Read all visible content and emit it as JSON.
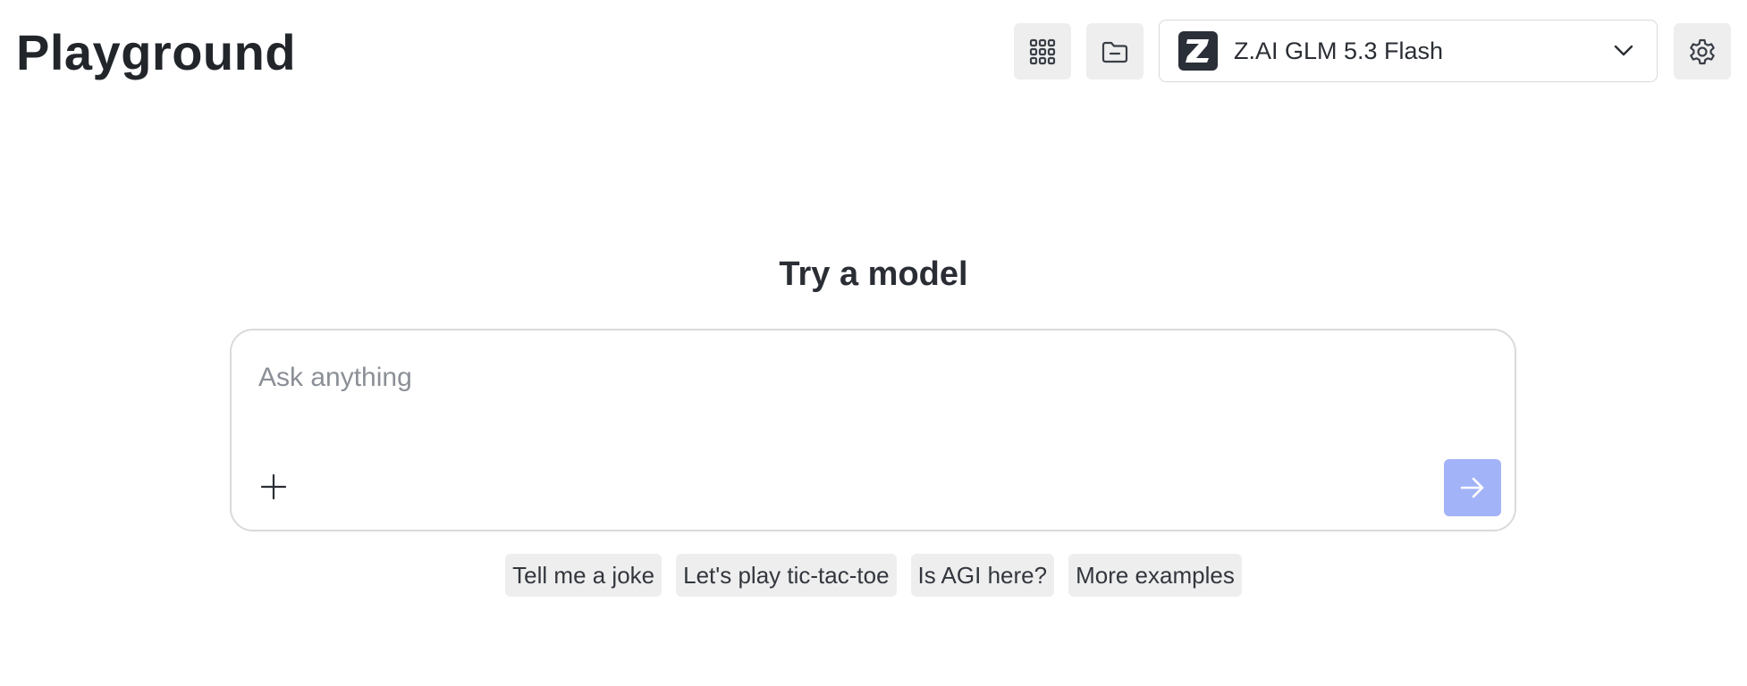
{
  "header": {
    "title": "Playground",
    "grid_button_icon": "grid-icon",
    "folder_button_icon": "folder-icon",
    "settings_button_icon": "gear-icon"
  },
  "model_selector": {
    "logo_icon": "zai-logo-icon",
    "selected_model": "Z.AI GLM 5.3 Flash",
    "dropdown_icon": "chevron-down-icon"
  },
  "main": {
    "heading": "Try a model"
  },
  "composer": {
    "placeholder": "Ask anything",
    "value": "",
    "attach_icon": "plus-icon",
    "send_icon": "arrow-right-icon",
    "send_button_color": "#a3b3f7"
  },
  "suggestions": [
    {
      "label": "Tell me a joke"
    },
    {
      "label": "Let's play tic-tac-toe"
    },
    {
      "label": "Is AGI here?"
    },
    {
      "label": "More examples"
    }
  ]
}
